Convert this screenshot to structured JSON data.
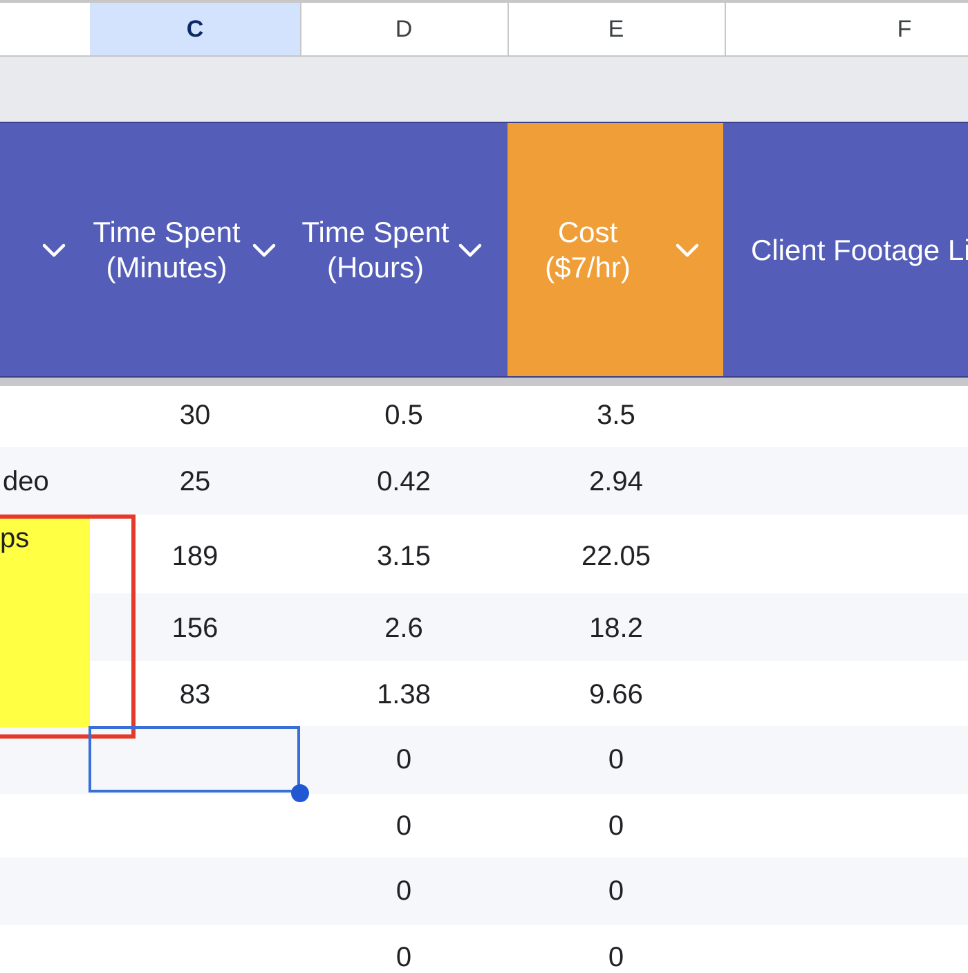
{
  "column_headers": {
    "c": "C",
    "d": "D",
    "e": "E",
    "f": "F"
  },
  "table_header": {
    "minutes": [
      "Time Spent",
      "(Minutes)"
    ],
    "hours": [
      "Time Spent",
      "(Hours)"
    ],
    "cost": [
      "Cost",
      "($7/hr)"
    ],
    "footage": "Client Footage Li"
  },
  "colors": {
    "header_purple": "#545db8",
    "cost_orange": "#f09e38",
    "highlight_yellow": "#ffff44",
    "annotation_red": "#e53a2a",
    "selection_blue": "#3a6fd8"
  },
  "rows": [
    {
      "b": "",
      "minutes": "30",
      "hours": "0.5",
      "cost": "3.5"
    },
    {
      "b": "deo",
      "minutes": "25",
      "hours": "0.42",
      "cost": "2.94"
    },
    {
      "b": "ps",
      "minutes": "189",
      "hours": "3.15",
      "cost": "22.05"
    },
    {
      "b": "",
      "minutes": "156",
      "hours": "2.6",
      "cost": "18.2"
    },
    {
      "b": "",
      "minutes": "83",
      "hours": "1.38",
      "cost": "9.66"
    },
    {
      "b": "",
      "minutes": "",
      "hours": "0",
      "cost": "0"
    },
    {
      "b": "",
      "minutes": "",
      "hours": "0",
      "cost": "0"
    },
    {
      "b": "",
      "minutes": "",
      "hours": "0",
      "cost": "0"
    },
    {
      "b": "",
      "minutes": "",
      "hours": "0",
      "cost": "0"
    }
  ]
}
